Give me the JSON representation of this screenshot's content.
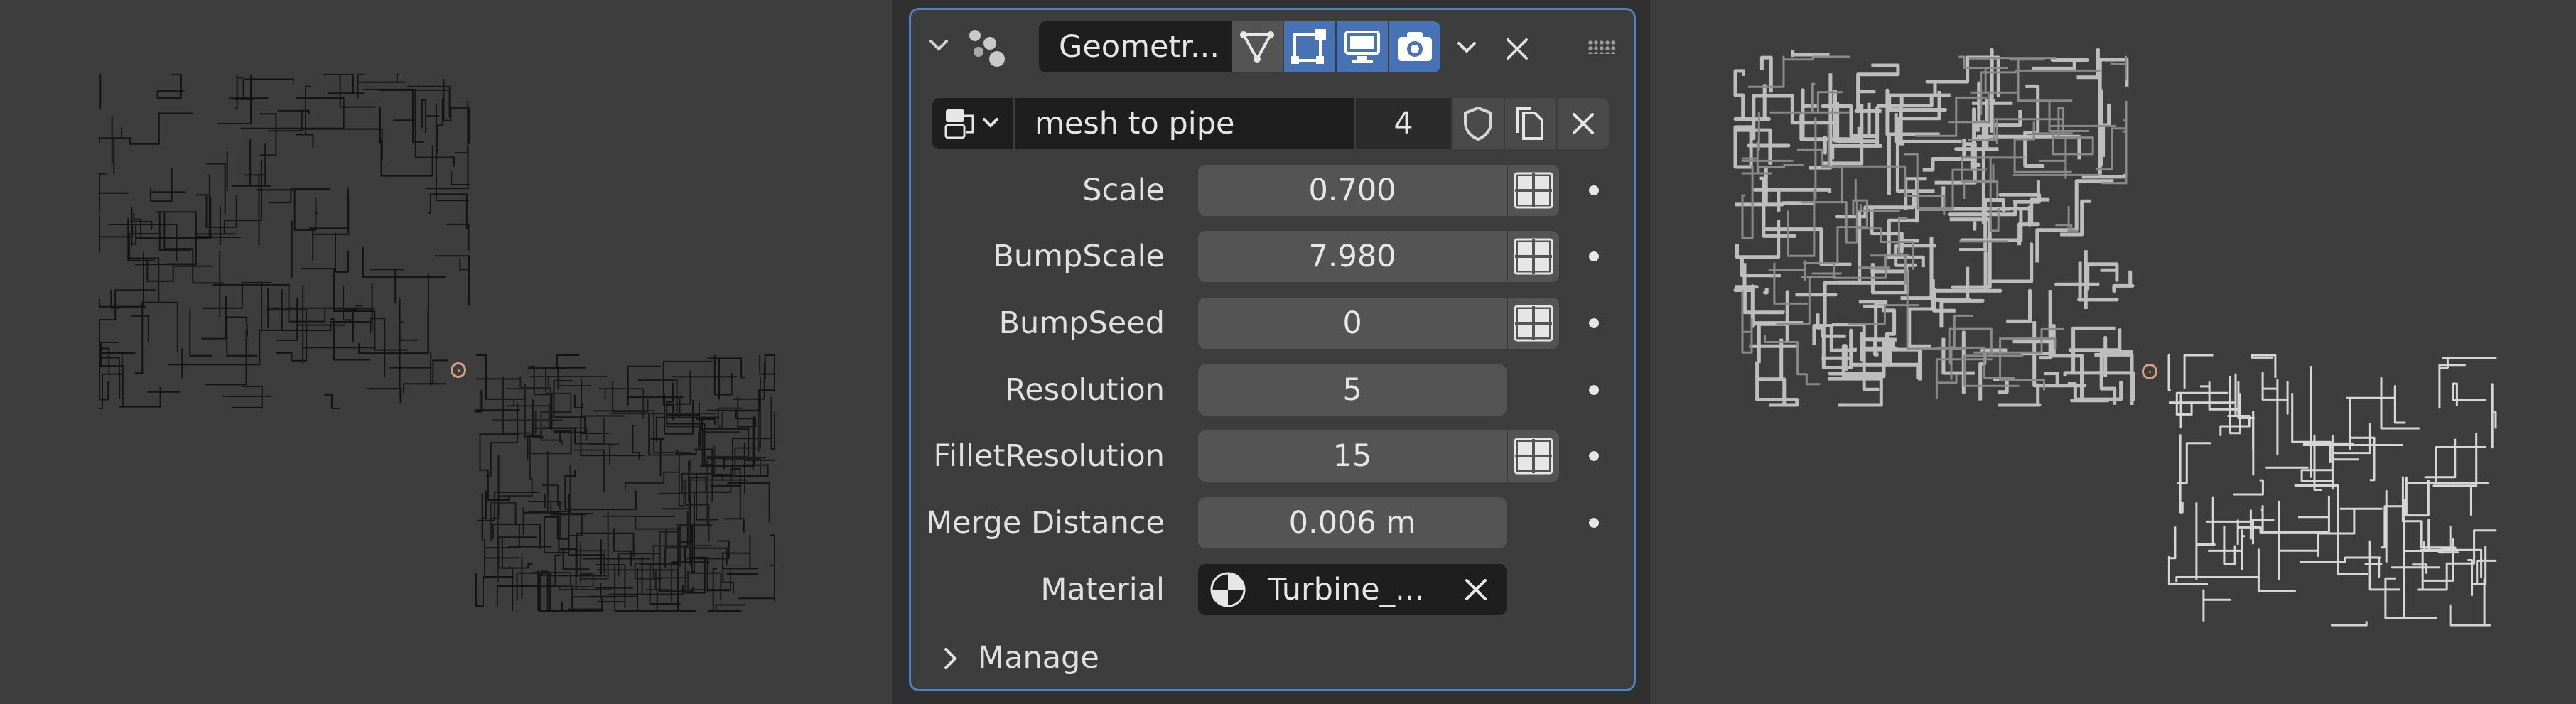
{
  "header": {
    "modifier_name": "Geometr...",
    "buttons": [
      "edit-mode",
      "on-cage",
      "viewport",
      "render"
    ]
  },
  "node_group": {
    "name": "mesh to pipe",
    "users": "4"
  },
  "fields": [
    {
      "label": "Scale",
      "value": "0.700",
      "has_toggle": true
    },
    {
      "label": "BumpScale",
      "value": "7.980",
      "has_toggle": true
    },
    {
      "label": "BumpSeed",
      "value": "0",
      "has_toggle": true
    },
    {
      "label": "Resolution",
      "value": "5",
      "has_toggle": false
    },
    {
      "label": "FilletResolution",
      "value": "15",
      "has_toggle": true
    },
    {
      "label": "Merge Distance",
      "value": "0.006 m",
      "has_toggle": false
    }
  ],
  "material": {
    "label": "Material",
    "value": "Turbine_..."
  },
  "manage": {
    "label": "Manage"
  },
  "colors": {
    "panel_border": "#4f80c6",
    "active_button": "#4772b3",
    "field": "#545454",
    "viewport": "#3d3d3d"
  }
}
